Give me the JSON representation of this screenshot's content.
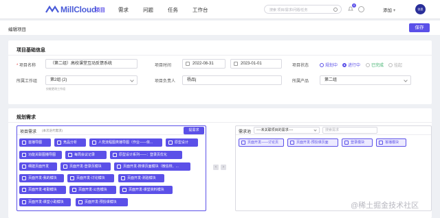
{
  "nav": {
    "logo": "MillCloud",
    "menu": [
      "项目",
      "需求",
      "问题",
      "任务",
      "工作台"
    ],
    "search_placeholder": "搜索 项目/需求/问题/任务",
    "notif_count": "0",
    "add_label": "添加 +",
    "avatar_text": "徐思"
  },
  "subhead": {
    "title": "编辑项目",
    "save_label": "保存"
  },
  "basic": {
    "title": "项目基础信息",
    "name_label": "项目名称",
    "name_value": "（第二组）高校课堂互动反馈系统",
    "time_label": "项目时间",
    "start_date": "2022-08-31",
    "end_date": "2023-01-01",
    "status_label": "项目状态",
    "status_options": [
      "规划中",
      "进行中",
      "已完成",
      "挂起"
    ],
    "group_label": "所属工作组",
    "group_value": "第2组 (2)",
    "group_hint": "仅能更改工作组",
    "owner_label": "项目负责人",
    "owner_value": "杨品|",
    "product_label": "所属产品",
    "product_value": "第二组"
  },
  "plan": {
    "title": "规划需求",
    "left_title": "项目需求",
    "left_sub": "(本次迭代需求)",
    "pick_btn": "提需求",
    "left_tags": [
      "首播导图",
      "竞品分析",
      "人党流程图类播导图（作业——依...",
      "原型设计",
      "功能关联图播导图",
      "每周会议记录",
      "原型设计系列——：登录页优化",
      "细建页面开发",
      "页面开发-登录页模块",
      "页面开发-搜课页面模块（微信校、...",
      "页面开发-我的模块",
      "页面开发-讨论模块",
      "页面开发-测验模块",
      "页面开发-考勤模块",
      "页面开发-公告模块",
      "页面开发-课堂资料模块",
      "页面开发-课堂小助模块",
      "页面开发-预授课模块"
    ],
    "pool_title": "需求池",
    "pool_select": "----未关联项目的需求----",
    "pool_search_placeholder": "搜索需求",
    "right_tags": [
      "页面开发——讨论页",
      "页面开发-预授课页面",
      "登录模块",
      "答播模块"
    ]
  },
  "watermark": "@稀土掘金技术社区",
  "colors": {
    "accent": "#5b50e8",
    "danger": "#e54545"
  }
}
